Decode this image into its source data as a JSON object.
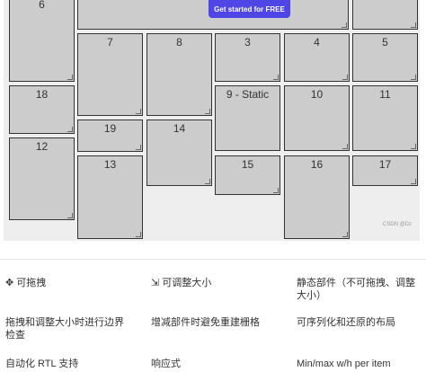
{
  "cta": {
    "label": "Get started for FREE"
  },
  "grid_items": [
    "6",
    "7",
    "8",
    "3",
    "4",
    "5",
    "18",
    "9 - Static",
    "10",
    "11",
    "19",
    "14",
    "12",
    "13",
    "15",
    "16",
    "17"
  ],
  "features": [
    "✥ 可拖拽",
    "⇲ 可调整大小",
    "静态部件（不可拖拽、调整大小）",
    "拖拽和调整大小时进行边界检查",
    "增减部件时避免重建栅格",
    "可序列化和还原的布局",
    "自动化 RTL 支持",
    "响应式",
    "Min/max w/h per item"
  ],
  "watermark": "CSDN @Dz"
}
